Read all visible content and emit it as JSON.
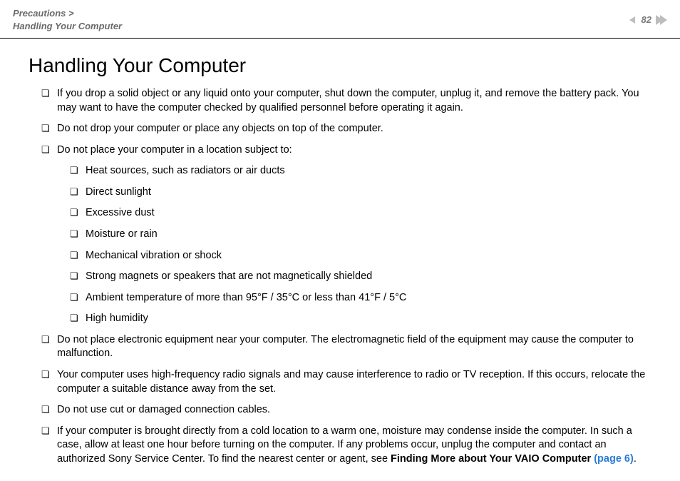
{
  "header": {
    "breadcrumb_parent": "Precautions >",
    "breadcrumb_current": "Handling Your Computer",
    "page_number": "82"
  },
  "main": {
    "title": "Handling Your Computer",
    "items": [
      {
        "text": "If you drop a solid object or any liquid onto your computer, shut down the computer, unplug it, and remove the battery pack. You may want to have the computer checked by qualified personnel before operating it again."
      },
      {
        "text": "Do not drop your computer or place any objects on top of the computer."
      },
      {
        "text": "Do not place your computer in a location subject to:",
        "sub": [
          "Heat sources, such as radiators or air ducts",
          "Direct sunlight",
          "Excessive dust",
          "Moisture or rain",
          "Mechanical vibration or shock",
          "Strong magnets or speakers that are not magnetically shielded",
          "Ambient temperature of more than 95°F / 35°C or less than 41°F / 5°C",
          "High humidity"
        ]
      },
      {
        "text": "Do not place electronic equipment near your computer. The electromagnetic field of the equipment may cause the computer to malfunction."
      },
      {
        "text": "Your computer uses high-frequency radio signals and may cause interference to radio or TV reception. If this occurs, relocate the computer a suitable distance away from the set."
      },
      {
        "text": "Do not use cut or damaged connection cables."
      },
      {
        "text_pre": "If your computer is brought directly from a cold location to a warm one, moisture may condense inside the computer. In such a case, allow at least one hour before turning on the computer. If any problems occur, unplug the computer and contact an authorized Sony Service Center. To find the nearest center or agent, see ",
        "bold": "Finding More about Your VAIO Computer ",
        "link": "(page 6)",
        "text_post": "."
      }
    ]
  }
}
